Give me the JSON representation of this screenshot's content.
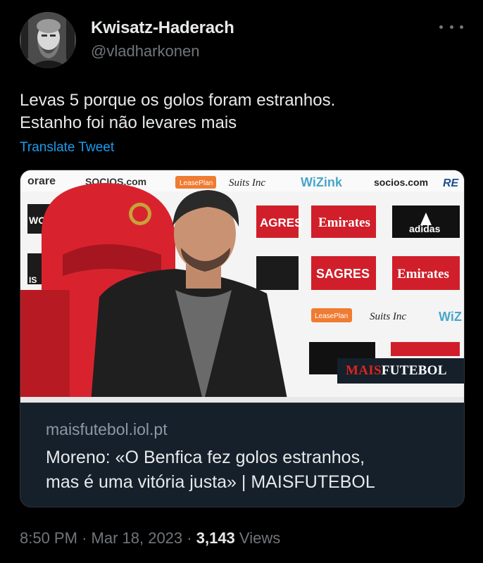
{
  "author": {
    "display_name": "Kwisatz-Haderach",
    "handle": "@vladharkonen",
    "avatar_icon": "profile-avatar"
  },
  "more_icon": "more-options-icon",
  "tweet": {
    "lines": [
      "Levas 5 porque os golos foram estranhos.",
      "Estanho foi não levares mais"
    ],
    "translate_label": "Translate Tweet"
  },
  "card": {
    "domain": "maisfutebol.iol.pt",
    "title_lines": [
      "Moreno: «O Benfica fez golos estranhos,",
      "mas é uma vitória justa» | MAISFUTEBOL"
    ],
    "image": {
      "overlay_brand_a": "MAIS",
      "overlay_brand_b": "FUTEBOL",
      "sponsors": [
        "Emirates",
        "SAGRES",
        "adidas",
        "WiZink",
        "socios.com",
        "LeasePlan",
        "Suits Inc"
      ]
    }
  },
  "footer": {
    "time": "8:50 PM",
    "separator": "·",
    "date": "Mar 18, 2023",
    "views_count": "3,143",
    "views_label": "Views"
  },
  "colors": {
    "background": "#000000",
    "text_primary": "#e7e9ea",
    "text_secondary": "#71767b",
    "link": "#1d9bf0",
    "card_bg": "#15202b"
  }
}
